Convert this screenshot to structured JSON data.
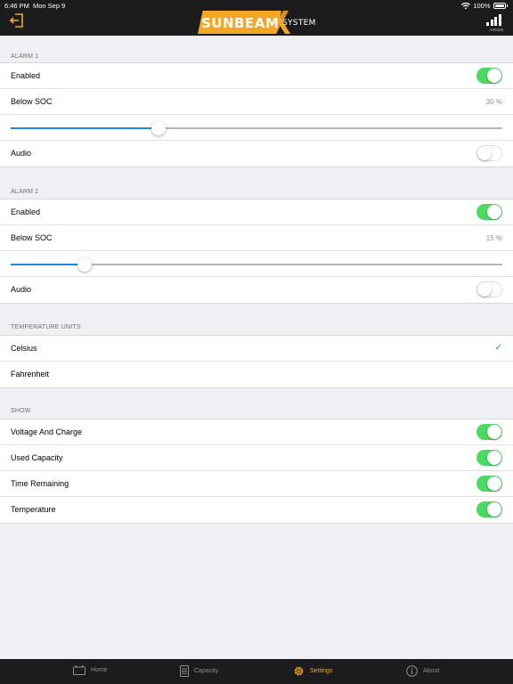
{
  "status_bar": {
    "time": "6:46 PM",
    "date": "Mon Sep 9",
    "battery": "100%"
  },
  "nav": {
    "exit_icon": "exit-icon",
    "logo": {
      "sun": "SUNBEAM",
      "system": "SYSTEM"
    },
    "device_code": "A00428",
    "colors": {
      "accent": "#f5a623",
      "bar": "#1c1c1e"
    }
  },
  "alarm1": {
    "header": "ALARM 1",
    "enabled_label": "Enabled",
    "enabled": true,
    "below_soc_label": "Below SOC",
    "below_soc_value": "30 %",
    "slider_fraction": 0.3,
    "audio_label": "Audio",
    "audio": false
  },
  "alarm2": {
    "header": "ALARM 2",
    "enabled_label": "Enabled",
    "enabled": true,
    "below_soc_label": "Below SOC",
    "below_soc_value": "15 %",
    "slider_fraction": 0.15,
    "audio_label": "Audio",
    "audio": false
  },
  "temperature_units": {
    "header": "TEMPERATURE UNITS",
    "options": [
      "Celsius",
      "Fahrenheit"
    ],
    "selected": "Celsius"
  },
  "show": {
    "header": "SHOW",
    "items": [
      {
        "label": "Voltage And Charge",
        "on": true
      },
      {
        "label": "Used Capacity",
        "on": true
      },
      {
        "label": "Time Remaining",
        "on": true
      },
      {
        "label": "Temperature",
        "on": true
      }
    ]
  },
  "tabs": [
    {
      "label": "Home",
      "icon": "battery-icon",
      "active": false
    },
    {
      "label": "Capacity",
      "icon": "battery-stack-icon",
      "active": false
    },
    {
      "label": "Settings",
      "icon": "gear-icon",
      "active": true
    },
    {
      "label": "About",
      "icon": "info-icon",
      "active": false
    }
  ],
  "colors": {
    "toggle_on": "#4cd964",
    "slider": "#1e88e5",
    "checkmark": "#1e88e5"
  }
}
